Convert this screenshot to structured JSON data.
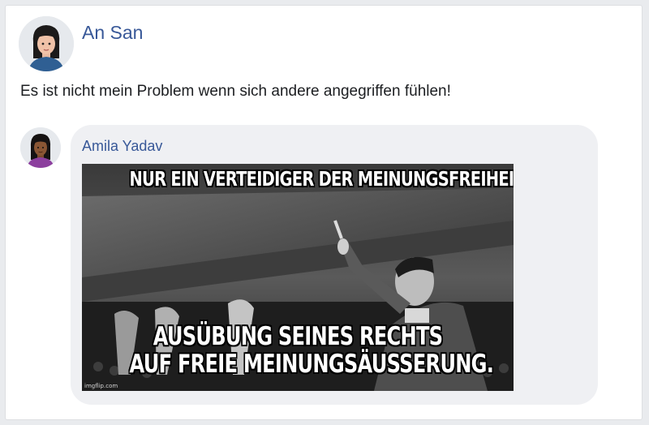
{
  "post": {
    "author": "An San",
    "text": "Es ist nicht mein Problem wenn sich andere angegriffen fühlen!"
  },
  "comment": {
    "author": "Amila Yadav",
    "meme": {
      "top_text": "NUR EIN VERTEIDIGER DER MEINUNGSFREIHEIT.",
      "bottom_line_1": "AUSÜBUNG SEINES RECHTS",
      "bottom_line_2": "AUF FREIE MEINUNGSÄUSSERUNG.",
      "watermark": "imgflip.com"
    }
  },
  "colors": {
    "link": "#385898",
    "bubble": "#eff0f3",
    "page_bg": "#e9ebee"
  }
}
